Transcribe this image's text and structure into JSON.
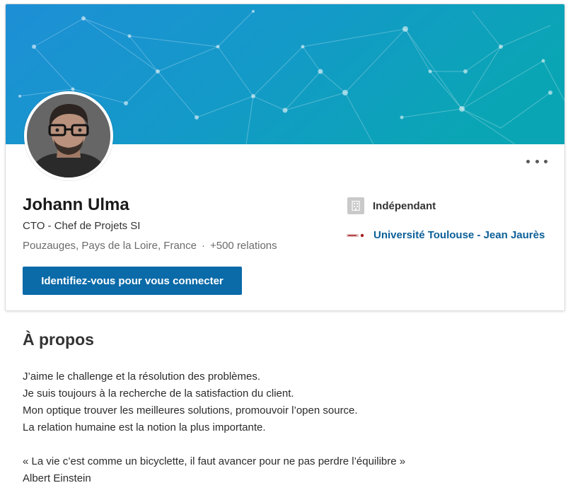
{
  "profile": {
    "name": "Johann Ulma",
    "headline": "CTO - Chef de Projets SI",
    "location": "Pouzauges, Pays de la Loire, France",
    "separator": "·",
    "connections": "+500 relations",
    "connect_label": "Identifiez-vous pour vous connecter",
    "company": "Indépendant",
    "school": "Université Toulouse - Jean Jaurès"
  },
  "about": {
    "title": "À propos",
    "lines": [
      "J’aime le challenge et la résolution des problèmes.",
      "Je suis toujours à la recherche de la satisfaction du client.",
      "Mon optique trouver les meilleures solutions, promouvoir l’open source.",
      "La relation humaine est la notion la plus importante."
    ],
    "quote": "« La vie c’est comme un bicyclette, il faut avancer pour ne pas perdre l’équilibre »",
    "quote_author": "Albert Einstein"
  },
  "colors": {
    "banner_left": "#1e8fd6",
    "banner_right": "#0aa5b5",
    "button": "#0b6aa8",
    "link": "#0b5f97"
  },
  "icons": {
    "more": "more-horizontal-icon",
    "company": "building-icon",
    "school": "university-logo"
  }
}
